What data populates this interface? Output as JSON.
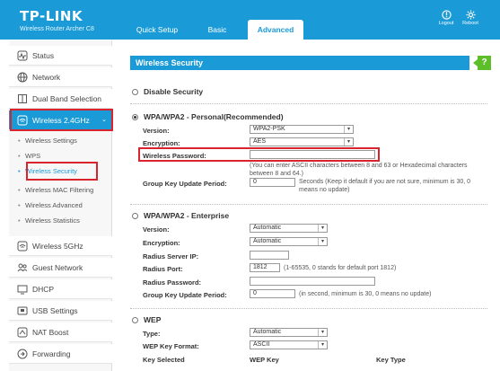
{
  "header": {
    "logo": "TP-LINK",
    "model": "Wireless Router Archer C8",
    "tabs": [
      {
        "label": "Quick Setup"
      },
      {
        "label": "Basic"
      },
      {
        "label": "Advanced"
      }
    ],
    "logout_label": "Logout",
    "reboot_label": "Reboot"
  },
  "sidebar": {
    "items": [
      {
        "label": "Status",
        "icon": "status-icon"
      },
      {
        "label": "Network",
        "icon": "globe-icon"
      },
      {
        "label": "Dual Band Selection",
        "icon": "dual-band-icon"
      },
      {
        "label": "Wireless 2.4GHz",
        "icon": "wireless-icon"
      },
      {
        "label": "Wireless 5GHz",
        "icon": "wireless-icon"
      },
      {
        "label": "Guest Network",
        "icon": "guest-icon"
      },
      {
        "label": "DHCP",
        "icon": "dhcp-icon"
      },
      {
        "label": "USB Settings",
        "icon": "usb-icon"
      },
      {
        "label": "NAT Boost",
        "icon": "nat-icon"
      },
      {
        "label": "Forwarding",
        "icon": "forwarding-icon"
      }
    ],
    "subitems": [
      {
        "label": "Wireless Settings"
      },
      {
        "label": "WPS"
      },
      {
        "label": "Wireless Security"
      },
      {
        "label": "Wireless MAC Filtering"
      },
      {
        "label": "Wireless Advanced"
      },
      {
        "label": "Wireless Statistics"
      }
    ]
  },
  "main": {
    "section_title": "Wireless Security",
    "help_label": "?",
    "disable": {
      "label": "Disable Security"
    },
    "personal": {
      "label": "WPA/WPA2 - Personal(Recommended)",
      "version_label": "Version:",
      "version_value": "WPA2-PSK",
      "encryption_label": "Encryption:",
      "encryption_value": "AES",
      "password_label": "Wireless Password:",
      "password_value": "",
      "password_note": "(You can enter ASCII characters between 8 and 63 or Hexadecimal characters between 8 and 64.)",
      "gkup_label": "Group Key Update Period:",
      "gkup_value": "0",
      "gkup_note": "Seconds (Keep it default if you are not sure, minimum is 30, 0 means no update)"
    },
    "enterprise": {
      "label": "WPA/WPA2 - Enterprise",
      "version_label": "Version:",
      "version_value": "Automatic",
      "encryption_label": "Encryption:",
      "encryption_value": "Automatic",
      "radius_ip_label": "Radius Server IP:",
      "radius_ip_value": "",
      "radius_port_label": "Radius Port:",
      "radius_port_value": "1812",
      "radius_port_note": "(1-65535, 0 stands for default port 1812)",
      "radius_pw_label": "Radius Password:",
      "radius_pw_value": "",
      "gkup_label": "Group Key Update Period:",
      "gkup_value": "0",
      "gkup_note": "(in second, minimum is 30, 0 means no update)"
    },
    "wep": {
      "label": "WEP",
      "type_label": "Type:",
      "type_value": "Automatic",
      "format_label": "WEP Key Format:",
      "format_value": "ASCII",
      "col_selected": "Key Selected",
      "col_key": "WEP Key",
      "col_type": "Key Type"
    }
  },
  "colors": {
    "brand": "#1a9bd7",
    "highlight": "#d9232d",
    "help": "#5cbf2a"
  }
}
